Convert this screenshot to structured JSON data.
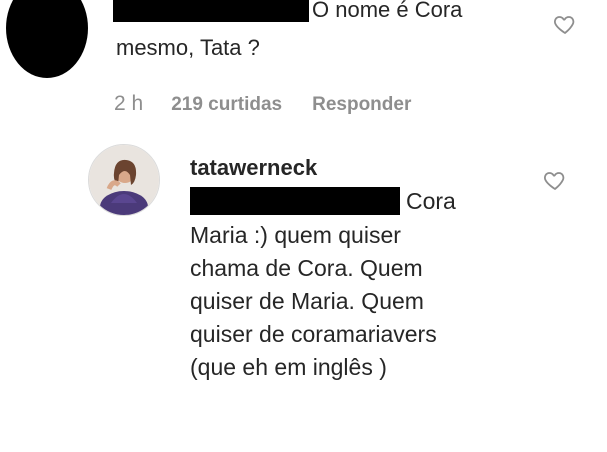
{
  "parent_comment": {
    "text_line1": "O nome é Cora",
    "text_line2": "mesmo, Tata ?",
    "time": "2 h",
    "likes": "219 curtidas",
    "reply_label": "Responder",
    "like_icon": "heart-outline-icon"
  },
  "reply_comment": {
    "username": "tatawerneck",
    "lines": [
      "Cora",
      "Maria :) quem quiser",
      "chama de Cora. Quem",
      "quiser de Maria. Quem",
      "quiser de coramariavers",
      "(que eh em inglês )"
    ],
    "like_icon": "heart-outline-icon"
  }
}
